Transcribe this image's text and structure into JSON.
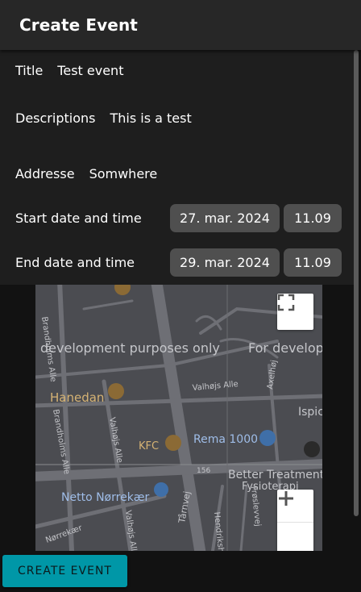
{
  "app": {
    "title": "Create Event"
  },
  "form": {
    "title_label": "Title",
    "title_value": "Test event",
    "description_label": "Descriptions",
    "description_value": "This is a test",
    "address_label": "Addresse",
    "address_value": "Somwhere",
    "start_label": "Start date and time",
    "start_date": "27. mar. 2024",
    "start_time": "11.09",
    "end_label": "End date and time",
    "end_date": "29. mar. 2024",
    "end_time": "11.09"
  },
  "map": {
    "watermark_1": "development purposes only",
    "watermark_2": "For developm",
    "streets": {
      "brandholms_alle_1": "Brandholms Alle",
      "brandholms_alle_2": "Brandholms Alle",
      "valhojs_alle_1": "Valhøjs Alle",
      "valhojs_alle_2": "Valhøjs Alle",
      "valhojs_alle_3": "Valhøjs Alle",
      "axelhoj": "Axelhøj",
      "tarnvej": "Tårnvej",
      "norrekaer": "Nørrekær",
      "hendriksholm": "Hendriksholms",
      "froslevvej": "Frøslevvej",
      "road_156": "156"
    },
    "places": {
      "hanedan": "Hanedan",
      "kfc": "KFC",
      "rema": "Rema 1000",
      "ispi": "Ispic",
      "better_treatment": "Better Treatment",
      "fysioterapi": "Fysioterapi",
      "netto": "Netto Nørrekær"
    }
  },
  "actions": {
    "create_label": "CREATE EVENT"
  }
}
